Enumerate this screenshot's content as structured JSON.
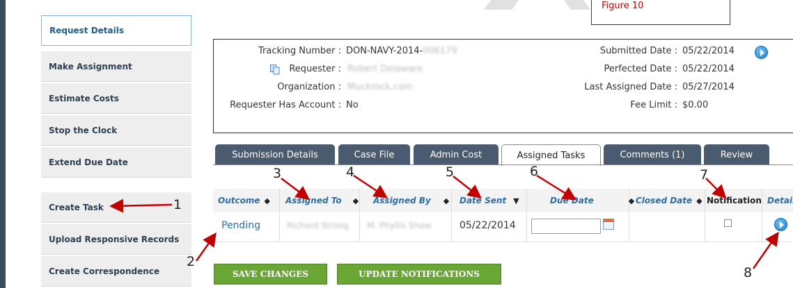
{
  "figure_label": "Figure 10",
  "sidebar": {
    "items": [
      {
        "label": "Request Details"
      },
      {
        "label": "Make Assignment"
      },
      {
        "label": "Estimate Costs"
      },
      {
        "label": "Stop the Clock"
      },
      {
        "label": "Extend Due Date"
      },
      {
        "label": "Create Task"
      },
      {
        "label": "Upload Responsive Records"
      },
      {
        "label": "Create Correspondence"
      }
    ]
  },
  "info": {
    "tracking_label": "Tracking Number :",
    "tracking_value": "DON-NAVY-2014-",
    "tracking_redacted": "006179",
    "requester_label": "Requester :",
    "requester_value": "Robert Delaware",
    "organization_label": "Organization :",
    "organization_value": "Muckrock.com",
    "has_account_label": "Requester Has Account :",
    "has_account_value": "No",
    "submitted_label": "Submitted Date :",
    "submitted_value": "05/22/2014",
    "perfected_label": "Perfected Date :",
    "perfected_value": "05/22/2014",
    "last_assigned_label": "Last Assigned Date :",
    "last_assigned_value": "05/27/2014",
    "fee_limit_label": "Fee Limit :",
    "fee_limit_value": "$0.00"
  },
  "tabs": [
    {
      "label": "Submission Details"
    },
    {
      "label": "Case File"
    },
    {
      "label": "Admin Cost"
    },
    {
      "label": "Assigned Tasks"
    },
    {
      "label": "Comments (1)"
    },
    {
      "label": "Review"
    }
  ],
  "table": {
    "headers": {
      "outcome": "Outcome",
      "assigned_to": "Assigned To",
      "assigned_by": "Assigned By",
      "date_sent": "Date Sent",
      "due_date": "Due Date",
      "closed_date": "Closed Date",
      "notification": "Notification",
      "details": "Details"
    },
    "row": {
      "outcome": "Pending",
      "assigned_to": "Richard Strong",
      "assigned_by": "M. Phyllis Shaw",
      "date_sent": "05/22/2014",
      "due_date": "",
      "closed_date": ""
    }
  },
  "buttons": {
    "save": "SAVE CHANGES",
    "update": "UPDATE NOTIFICATIONS"
  },
  "annotations": [
    "1",
    "2",
    "3",
    "4",
    "5",
    "6",
    "7",
    "8"
  ],
  "colors": {
    "accent_blue": "#2e6da4",
    "tab_bg": "#4a5b70",
    "button_green": "#6aa634",
    "annotation_red": "#c00000"
  }
}
